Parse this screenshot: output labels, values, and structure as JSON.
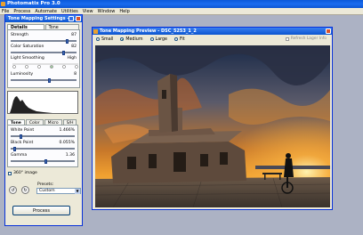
{
  "app": {
    "title": "Photomatix Pro 3.0"
  },
  "menu": [
    "File",
    "Process",
    "Automate",
    "Utilities",
    "View",
    "Window",
    "Help"
  ],
  "settings": {
    "title": "Tone Mapping Settings - D...",
    "tabs": [
      "Details Enhancer",
      "Tone Compressor"
    ],
    "controls": [
      {
        "label": "Strength",
        "value": "87",
        "level": 0.87
      },
      {
        "label": "Color Saturation",
        "value": "82",
        "level": 0.82
      }
    ],
    "smoothing": {
      "label": "Light Smoothing",
      "high": "High"
    },
    "luminosity": {
      "label": "Luminosity",
      "value": "8",
      "level": 0.6
    },
    "sub_tabs": [
      "Tone",
      "Color",
      "Micro",
      "S/H"
    ],
    "tone": [
      {
        "label": "White Point",
        "value": "1.466%",
        "level": 0.15
      },
      {
        "label": "Black Point",
        "value": "0.055%",
        "level": 0.05
      },
      {
        "label": "Gamma",
        "value": "1.36",
        "level": 0.55
      }
    ],
    "image360": "360° image",
    "presets_label": "Presets:",
    "presets_value": "Custom",
    "process_label": "Process"
  },
  "preview": {
    "title": "Tone Mapping Preview - DSC_5253_1_2",
    "sizes": [
      "Small",
      "Medium",
      "Large",
      "Fit"
    ],
    "selected_size": "Medium",
    "refresh": "Refresh Lager Info"
  }
}
